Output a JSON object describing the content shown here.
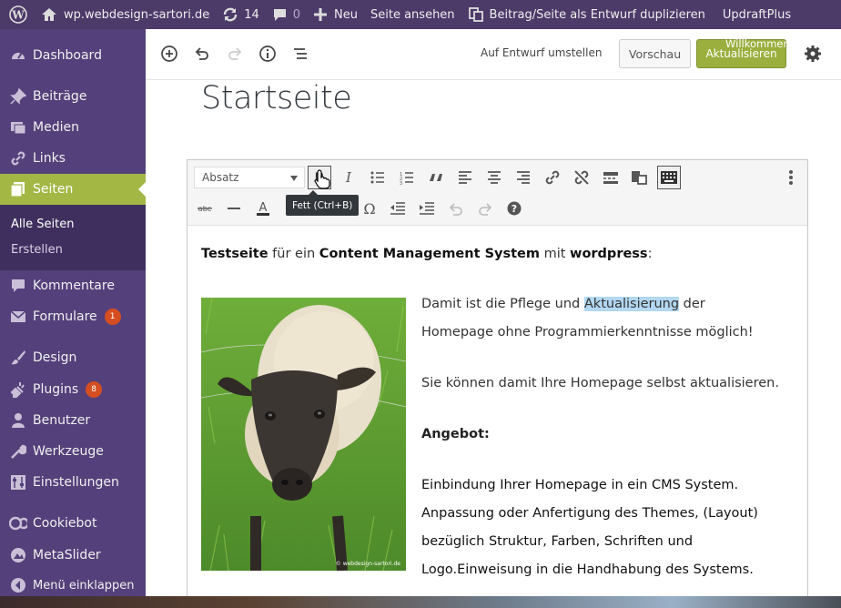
{
  "admin_bar": {
    "site_name": "wp.webdesign-sartori.de",
    "updates_count": "14",
    "comments_count": "0",
    "new_label": "Neu",
    "view_page_label": "Seite ansehen",
    "duplicate_label": "Beitrag/Seite als Entwurf duplizieren",
    "updraft_label": "UpdraftPlus"
  },
  "sidebar": {
    "items": [
      {
        "label": "Dashboard",
        "icon": "dashboard-icon"
      },
      {
        "label": "Beiträge",
        "icon": "pin-icon"
      },
      {
        "label": "Medien",
        "icon": "media-icon"
      },
      {
        "label": "Links",
        "icon": "link-icon"
      },
      {
        "label": "Seiten",
        "icon": "pages-icon",
        "active": true
      },
      {
        "label": "Kommentare",
        "icon": "comment-icon"
      },
      {
        "label": "Formulare",
        "icon": "mail-icon",
        "badge": "1"
      },
      {
        "label": "Design",
        "icon": "brush-icon"
      },
      {
        "label": "Plugins",
        "icon": "plugin-icon",
        "badge": "8"
      },
      {
        "label": "Benutzer",
        "icon": "user-icon"
      },
      {
        "label": "Werkzeuge",
        "icon": "wrench-icon"
      },
      {
        "label": "Einstellungen",
        "icon": "settings-icon"
      },
      {
        "label": "Cookiebot",
        "icon": "cookiebot-icon"
      },
      {
        "label": "MetaSlider",
        "icon": "metaslider-icon"
      },
      {
        "label": "Menü einklappen",
        "icon": "collapse-icon"
      }
    ],
    "submenu": [
      "Alle Seiten",
      "Erstellen"
    ]
  },
  "header": {
    "draft_link": "Auf Entwurf umstellen",
    "preview_label": "Vorschau",
    "update_label": "Aktualisieren",
    "welcome_overlay": "Willkommen"
  },
  "editor": {
    "title": "Startseite",
    "format_select": "Absatz",
    "tooltip": "Fett (Ctrl+B)",
    "intro_parts": [
      "Testseite",
      " für  ein ",
      "Content Management System",
      " mit ",
      "wordpress",
      ":"
    ],
    "para1_a": "Damit ist die Pflege und ",
    "para1_highlight": "Aktualisierung",
    "para1_b": " der",
    "para1_line2": "Homepage ohne Programmierkenntnisse möglich!",
    "para2": "Sie können damit Ihre Homepage selbst aktualisieren.",
    "heading": "Angebot:",
    "offer_lines": [
      "Einbindung Ihrer Homepage in ein CMS System.",
      "Anpassung oder Anfertigung des Themes, (Layout)",
      "bezüglich Struktur, Farben, Schriften und",
      "Logo.Einweisung in die Handhabung des Systems."
    ],
    "image_caption": "© webdesign-sartori.de"
  },
  "colors": {
    "admin_bar": "#4c3a69",
    "sidebar": "#54407a",
    "active": "#a3b745",
    "update_button": "#9aaf3e",
    "badge": "#d54e21"
  }
}
